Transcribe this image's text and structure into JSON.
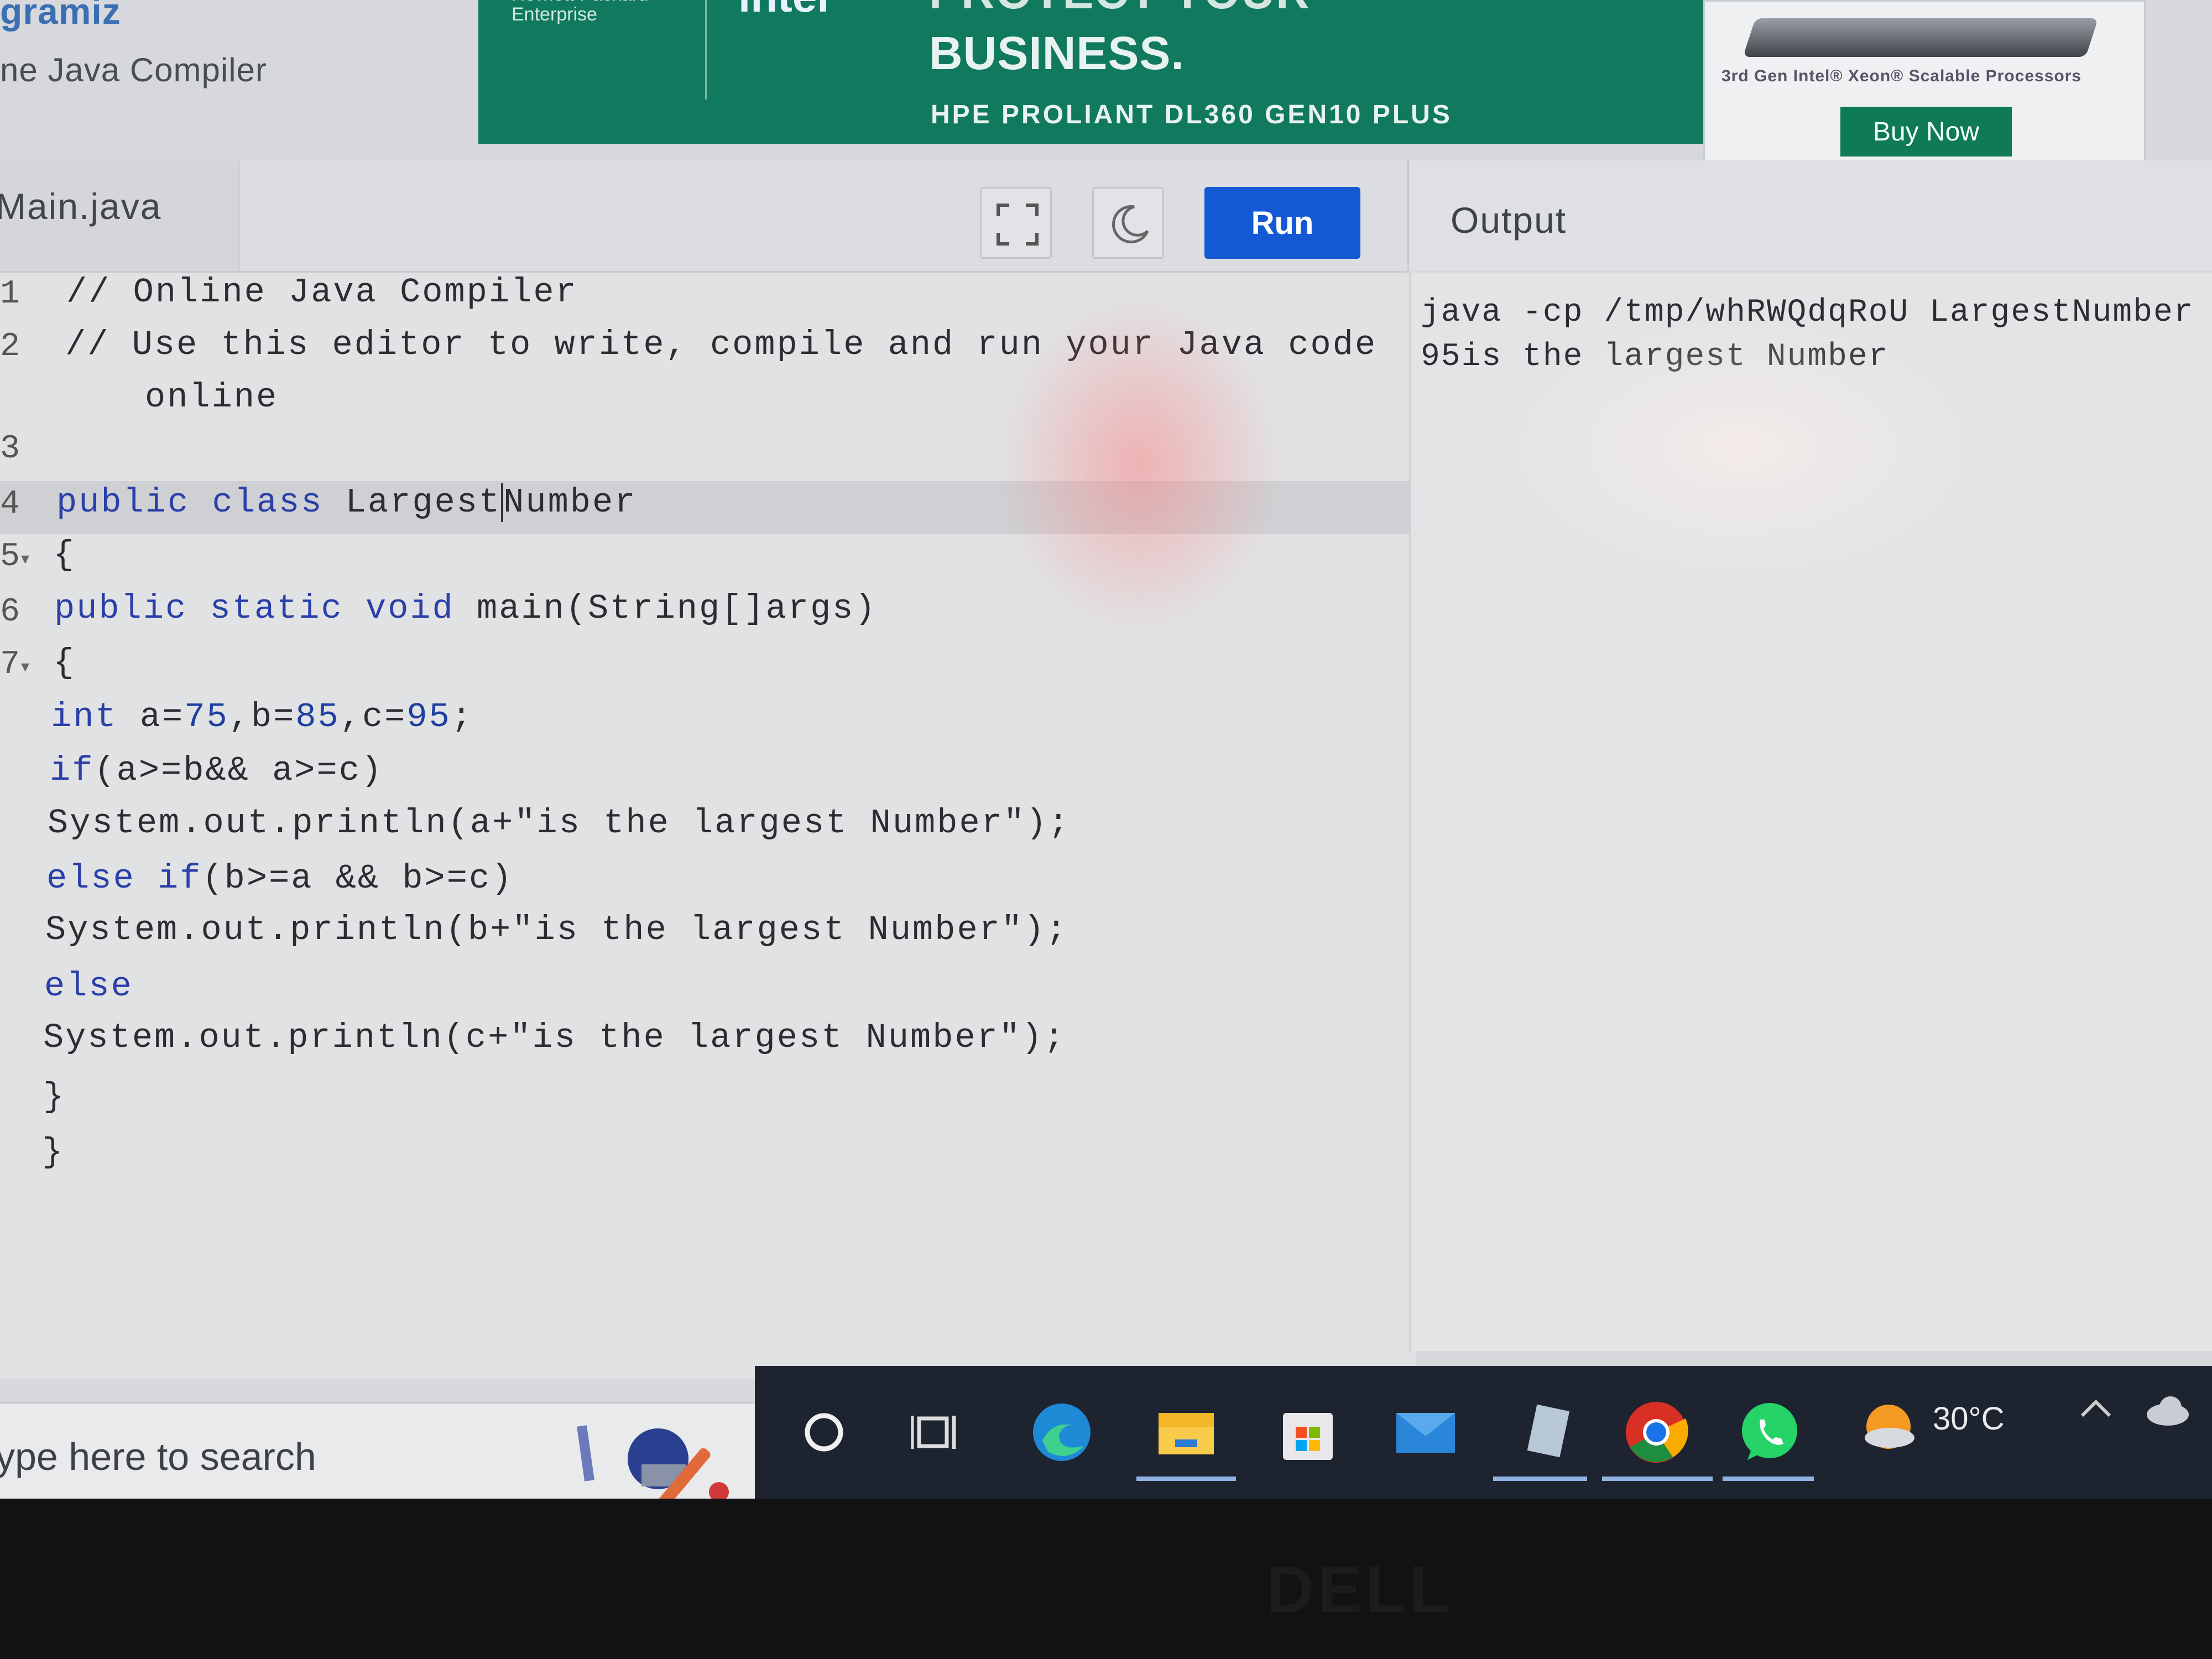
{
  "header": {
    "brand": "gramiz",
    "subtitle": "ne Java Compiler"
  },
  "ad": {
    "hpe_line1": "Hewlett Packard",
    "hpe_line2": "Enterprise",
    "intel": "intel",
    "headline_top": "PROTECT YOUR",
    "headline": "BUSINESS.",
    "model": "HPE PROLIANT DL360 GEN10 PLUS",
    "processor": "3rd Gen Intel® Xeon® Scalable Processors",
    "buy_label": "Buy Now",
    "bg_color": "#10795e"
  },
  "editor": {
    "file_tab": "Main.java",
    "run_label": "Run",
    "fullscreen_icon": "fullscreen-icon",
    "theme_icon": "moon-icon",
    "gutter": [
      "1",
      "2",
      "3",
      "4",
      "5",
      "6",
      "7"
    ],
    "lines": {
      "l1": "// Online Java Compiler",
      "l2a": "// Use this editor to write, compile and run your Java code",
      "l2b": "online",
      "l4_kw1": "public",
      "l4_kw2": "class",
      "l4_name_a": "Largest",
      "l4_name_b": "Number",
      "l5": "{",
      "l6_kw1": "public",
      "l6_kw2": "static",
      "l6_kw3": "void",
      "l6_rest": "main(String[]args)",
      "l7": "{",
      "l8_kw": "int",
      "l8_a": "a=",
      "l8_75": "75",
      "l8_b": ",b=",
      "l8_85": "85",
      "l8_c": ",c=",
      "l8_95": "95",
      "l8_end": ";",
      "l9_kw": "if",
      "l9_rest": "(a>=b&& a>=c)",
      "l10": "System.out.println(a+\"is the largest Number\");",
      "l11_kw1": "else",
      "l11_kw2": "if",
      "l11_rest": "(b>=a && b>=c)",
      "l12": "System.out.println(b+\"is the largest Number\");",
      "l13_kw": "else",
      "l14": "System.out.println(c+\"is the largest Number\");",
      "l15": "}",
      "l16": "}"
    },
    "keyword_color": "#2a3fa8"
  },
  "output": {
    "title": "Output",
    "lines": [
      "java -cp /tmp/whRWQdqRoU LargestNumber",
      "95is the largest Number"
    ]
  },
  "taskbar": {
    "search_placeholder": "ype here to search",
    "weather": "30°C",
    "icons": [
      "cortana-icon",
      "task-view-icon",
      "edge-icon",
      "file-explorer-icon",
      "store-icon",
      "mail-icon",
      "notepad-icon",
      "chrome-icon",
      "whatsapp-icon",
      "weather-icon",
      "chevron-up-icon",
      "onedrive-icon"
    ],
    "accent": "#1d2430"
  },
  "device": {
    "logo": "DELL"
  }
}
